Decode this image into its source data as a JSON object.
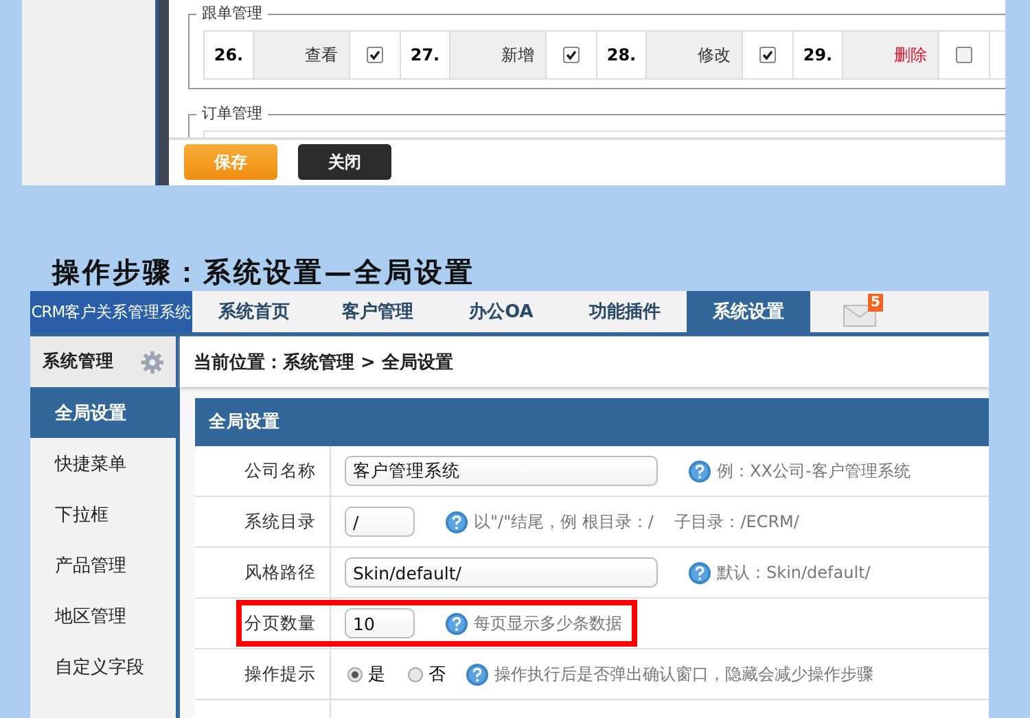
{
  "permission_screen": {
    "groups": [
      {
        "title": "跟单管理",
        "cells": [
          {
            "number": "26.",
            "label": "查看",
            "checked": true,
            "danger": false
          },
          {
            "number": "27.",
            "label": "新增",
            "checked": true,
            "danger": false
          },
          {
            "number": "28.",
            "label": "修改",
            "checked": true,
            "danger": false
          },
          {
            "number": "29.",
            "label": "删除",
            "checked": false,
            "danger": true
          }
        ]
      },
      {
        "title": "订单管理"
      }
    ],
    "buttons": [
      {
        "label": "保存",
        "kind": "primary"
      },
      {
        "label": "关闭",
        "kind": "dark"
      }
    ]
  },
  "heading": "操作步骤：系统设置—全局设置",
  "settings_screen": {
    "logo": "CRM客户关系管理系统",
    "tabs": [
      {
        "label": "系统首页",
        "selected": false
      },
      {
        "label": "客户管理",
        "selected": false
      },
      {
        "label": "办公OA",
        "selected": false
      },
      {
        "label": "功能插件",
        "selected": false
      },
      {
        "label": "系统设置",
        "selected": true
      }
    ],
    "mail_badge": "5",
    "sidebar": {
      "title": "系统管理",
      "items": [
        {
          "label": "全局设置",
          "selected": true
        },
        {
          "label": "快捷菜单",
          "selected": false
        },
        {
          "label": "下拉框",
          "selected": false
        },
        {
          "label": "产品管理",
          "selected": false
        },
        {
          "label": "地区管理",
          "selected": false
        },
        {
          "label": "自定义字段",
          "selected": false
        }
      ]
    },
    "breadcrumb": "当前位置：系统管理 > 全局设置",
    "panel_title": "全局设置",
    "rows": [
      {
        "kind": "textbox",
        "label": "公司名称",
        "value": "客户管理系统",
        "hint": "例：XX公司-客户管理系统",
        "highlighted": false
      },
      {
        "kind": "shortbox",
        "label": "系统目录",
        "value": "/",
        "hint": "以\"/\"结尾，例 根目录：/    子目录：/ECRM/",
        "highlighted": false
      },
      {
        "kind": "textbox",
        "label": "风格路径",
        "value": "Skin/default/",
        "hint": "默认：Skin/default/",
        "highlighted": false
      },
      {
        "kind": "shortbox",
        "label": "分页数量",
        "value": "10",
        "hint": "每页显示多少条数据",
        "highlighted": true
      },
      {
        "kind": "radio",
        "label": "操作提示",
        "options": [
          {
            "label": "是",
            "selected": true
          },
          {
            "label": "否",
            "selected": false
          }
        ],
        "hint": "操作执行后是否弹出确认窗口，隐藏会减少操作步骤",
        "highlighted": false
      }
    ]
  }
}
